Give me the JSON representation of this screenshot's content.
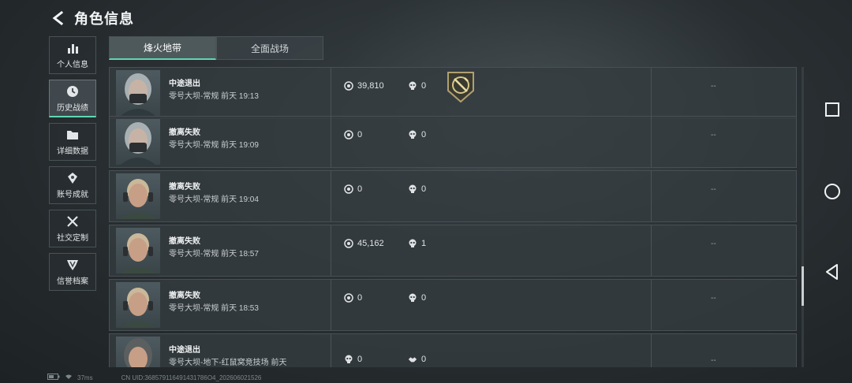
{
  "header": {
    "title": "角色信息"
  },
  "sidebar": {
    "items": [
      {
        "label": "个人信息",
        "icon": "bar-chart-icon"
      },
      {
        "label": "历史战绩",
        "icon": "clock-icon",
        "active": true
      },
      {
        "label": "详细数据",
        "icon": "folder-icon"
      },
      {
        "label": "账号成就",
        "icon": "medal-icon"
      },
      {
        "label": "社交定制",
        "icon": "tools-icon"
      },
      {
        "label": "信誉档案",
        "icon": "shield-icon"
      }
    ]
  },
  "tabs": [
    {
      "label": "烽火地带",
      "active": true
    },
    {
      "label": "全面战场",
      "active": false
    }
  ],
  "records": [
    {
      "title": "中途退出",
      "sub": "零号大坝-常规 前天 19:13",
      "value_icon": "coin-icon",
      "value": "39,810",
      "kills_icon": "skull-icon",
      "kills": "0",
      "badge": "sword-badge-icon",
      "extra": "--",
      "avatar": "masked-operator"
    },
    {
      "title": "撤离失败",
      "sub": "零号大坝-常规 前天 19:09",
      "value_icon": "coin-icon",
      "value": "0",
      "kills_icon": "skull-icon",
      "kills": "0",
      "extra": "--",
      "avatar": "masked-operator"
    },
    {
      "title": "撤离失败",
      "sub": "零号大坝-常规 前天 19:04",
      "value_icon": "coin-icon",
      "value": "0",
      "kills_icon": "skull-icon",
      "kills": "0",
      "extra": "--",
      "avatar": "headset-operator"
    },
    {
      "title": "撤离失败",
      "sub": "零号大坝-常规 前天 18:57",
      "value_icon": "coin-icon",
      "value": "45,162",
      "kills_icon": "skull-icon",
      "kills": "1",
      "extra": "--",
      "avatar": "headset-operator"
    },
    {
      "title": "撤离失败",
      "sub": "零号大坝-常规 前天 18:53",
      "value_icon": "coin-icon",
      "value": "0",
      "kills_icon": "skull-icon",
      "kills": "0",
      "extra": "--",
      "avatar": "headset-operator"
    },
    {
      "title": "中途退出",
      "sub": "零号大坝-地下-红鼠窝竞技场 前天",
      "value_icon": "skull-icon",
      "value": "0",
      "kills_icon": "handshake-icon",
      "kills": "0",
      "extra": "--",
      "avatar": "longhair-operator"
    }
  ],
  "status_bar": {
    "ping": "37ms",
    "uid": "CN UID:368579116491431786O4_202606021526"
  },
  "colors": {
    "accent": "#5fd7b4",
    "panel": "#343c40",
    "text": "#d9dde0"
  }
}
